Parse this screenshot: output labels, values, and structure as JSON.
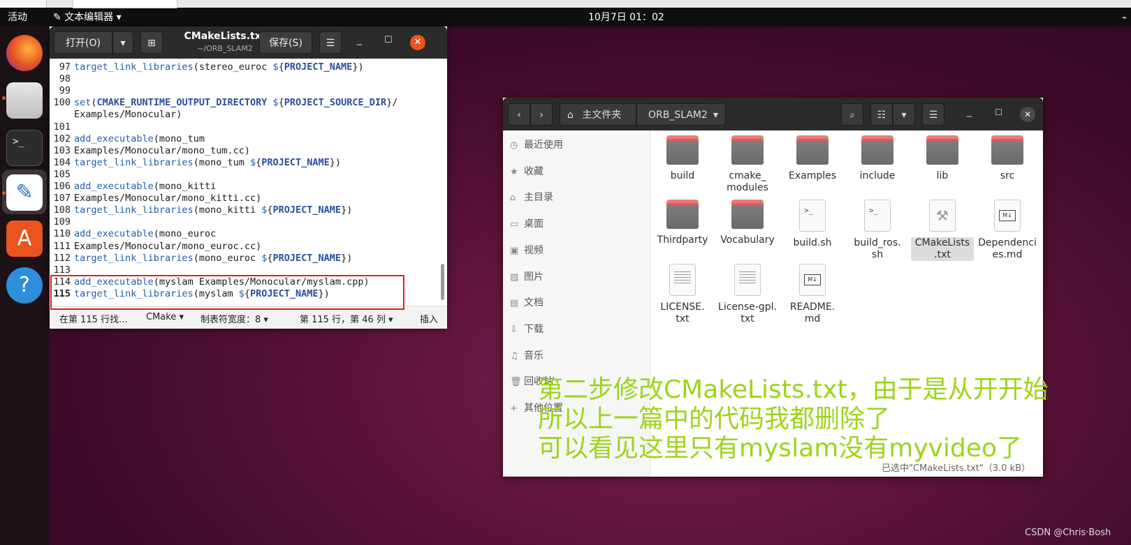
{
  "topbar": {
    "activities": "活动",
    "app_menu": "文本编辑器 ▾",
    "clock": "10月7日 01：02"
  },
  "dock": {
    "apps": [
      "firefox-icon",
      "files-icon",
      "terminal-icon",
      "text-editor-icon",
      "software-icon",
      "help-icon"
    ]
  },
  "editor": {
    "open_label": "打开(O)",
    "save_label": "保存(S)",
    "title": "CMakeLists.txt",
    "subtitle": "~/ORB_SLAM2",
    "lines": [
      {
        "n": "97",
        "parts": [
          [
            "fn",
            "target_link_libraries"
          ],
          [
            "t",
            "(stereo_euroc "
          ],
          [
            "cv",
            "$"
          ],
          [
            "t",
            "{"
          ],
          [
            "vr",
            "PROJECT_NAME"
          ],
          [
            "t",
            "})"
          ]
        ]
      },
      {
        "n": "98",
        "parts": []
      },
      {
        "n": "99",
        "parts": []
      },
      {
        "n": "100",
        "parts": [
          [
            "fn",
            "set"
          ],
          [
            "t",
            "("
          ],
          [
            "vr",
            "CMAKE_RUNTIME_OUTPUT_DIRECTORY"
          ],
          [
            "t",
            " "
          ],
          [
            "cv",
            "$"
          ],
          [
            "t",
            "{"
          ],
          [
            "vr",
            "PROJECT_SOURCE_DIR"
          ],
          [
            "t",
            "}/"
          ]
        ]
      },
      {
        "n": "",
        "parts": [
          [
            "t",
            "Examples/Monocular)"
          ]
        ]
      },
      {
        "n": "101",
        "parts": []
      },
      {
        "n": "102",
        "parts": [
          [
            "fn",
            "add_executable"
          ],
          [
            "t",
            "(mono_tum"
          ]
        ]
      },
      {
        "n": "103",
        "parts": [
          [
            "t",
            "Examples/Monocular/mono_tum.cc)"
          ]
        ]
      },
      {
        "n": "104",
        "parts": [
          [
            "fn",
            "target_link_libraries"
          ],
          [
            "t",
            "(mono_tum "
          ],
          [
            "cv",
            "$"
          ],
          [
            "t",
            "{"
          ],
          [
            "vr",
            "PROJECT_NAME"
          ],
          [
            "t",
            "})"
          ]
        ]
      },
      {
        "n": "105",
        "parts": []
      },
      {
        "n": "106",
        "parts": [
          [
            "fn",
            "add_executable"
          ],
          [
            "t",
            "(mono_kitti"
          ]
        ]
      },
      {
        "n": "107",
        "parts": [
          [
            "t",
            "Examples/Monocular/mono_kitti.cc)"
          ]
        ]
      },
      {
        "n": "108",
        "parts": [
          [
            "fn",
            "target_link_libraries"
          ],
          [
            "t",
            "(mono_kitti "
          ],
          [
            "cv",
            "$"
          ],
          [
            "t",
            "{"
          ],
          [
            "vr",
            "PROJECT_NAME"
          ],
          [
            "t",
            "})"
          ]
        ]
      },
      {
        "n": "109",
        "parts": []
      },
      {
        "n": "110",
        "parts": [
          [
            "fn",
            "add_executable"
          ],
          [
            "t",
            "(mono_euroc"
          ]
        ]
      },
      {
        "n": "111",
        "parts": [
          [
            "t",
            "Examples/Monocular/mono_euroc.cc)"
          ]
        ]
      },
      {
        "n": "112",
        "parts": [
          [
            "fn",
            "target_link_libraries"
          ],
          [
            "t",
            "(mono_euroc "
          ],
          [
            "cv",
            "$"
          ],
          [
            "t",
            "{"
          ],
          [
            "vr",
            "PROJECT_NAME"
          ],
          [
            "t",
            "})"
          ]
        ]
      },
      {
        "n": "113",
        "parts": []
      },
      {
        "n": "114",
        "parts": [
          [
            "fn",
            "add_executable"
          ],
          [
            "t",
            "(myslam Examples/Monocular/myslam.cpp)"
          ]
        ]
      },
      {
        "n": "115",
        "parts": [
          [
            "fn",
            "target_link_libraries"
          ],
          [
            "t",
            "(myslam "
          ],
          [
            "cv",
            "$"
          ],
          [
            "t",
            "{"
          ],
          [
            "vr",
            "PROJECT_NAME"
          ],
          [
            "t",
            "})"
          ]
        ]
      }
    ],
    "status": {
      "find": "在第 115 行找...",
      "lang": "CMake ▾",
      "tab": "制表符宽度：8 ▾",
      "pos": "第 115 行，第 46 列 ▾",
      "mode": "插入"
    }
  },
  "files": {
    "home": "主文件夹",
    "folder": "ORB_SLAM2",
    "sidebar": [
      "最近使用",
      "收藏",
      "主目录",
      "桌面",
      "视频",
      "图片",
      "文档",
      "下载",
      "音乐",
      "回收站",
      "其他位置"
    ],
    "sidebar_icons": [
      "clock-icon",
      "star-icon",
      "home-icon",
      "desktop-icon",
      "video-icon",
      "picture-icon",
      "document-icon",
      "download-icon",
      "music-icon",
      "trash-icon",
      "plus-icon"
    ],
    "items": [
      {
        "name": "build",
        "kind": "folder"
      },
      {
        "name": "cmake_\nmodules",
        "kind": "folder"
      },
      {
        "name": "Examples",
        "kind": "folder"
      },
      {
        "name": "include",
        "kind": "folder"
      },
      {
        "name": "lib",
        "kind": "folder"
      },
      {
        "name": "src",
        "kind": "folder"
      },
      {
        "name": "Thirdparty",
        "kind": "folder"
      },
      {
        "name": "Vocabulary",
        "kind": "folder"
      },
      {
        "name": "build.sh",
        "kind": "script"
      },
      {
        "name": "build_ros.\nsh",
        "kind": "script"
      },
      {
        "name": "CMakeLists\n.txt",
        "kind": "cmake",
        "selected": true
      },
      {
        "name": "Dependenci\nes.md",
        "kind": "md"
      },
      {
        "name": "LICENSE.\ntxt",
        "kind": "text"
      },
      {
        "name": "License-gpl.\ntxt",
        "kind": "text"
      },
      {
        "name": "README.\nmd",
        "kind": "md"
      }
    ],
    "status": "已选中\"CMakeLists.txt\"（3.0 kB）"
  },
  "overlay": {
    "lines": [
      "第二步修改CMakeLists.txt，由于是从开开始",
      "所以上一篇中的代码我都删除了",
      "可以看见这里只有myslam没有myvideo了"
    ]
  },
  "watermark": "CSDN @Chris·Bosh"
}
